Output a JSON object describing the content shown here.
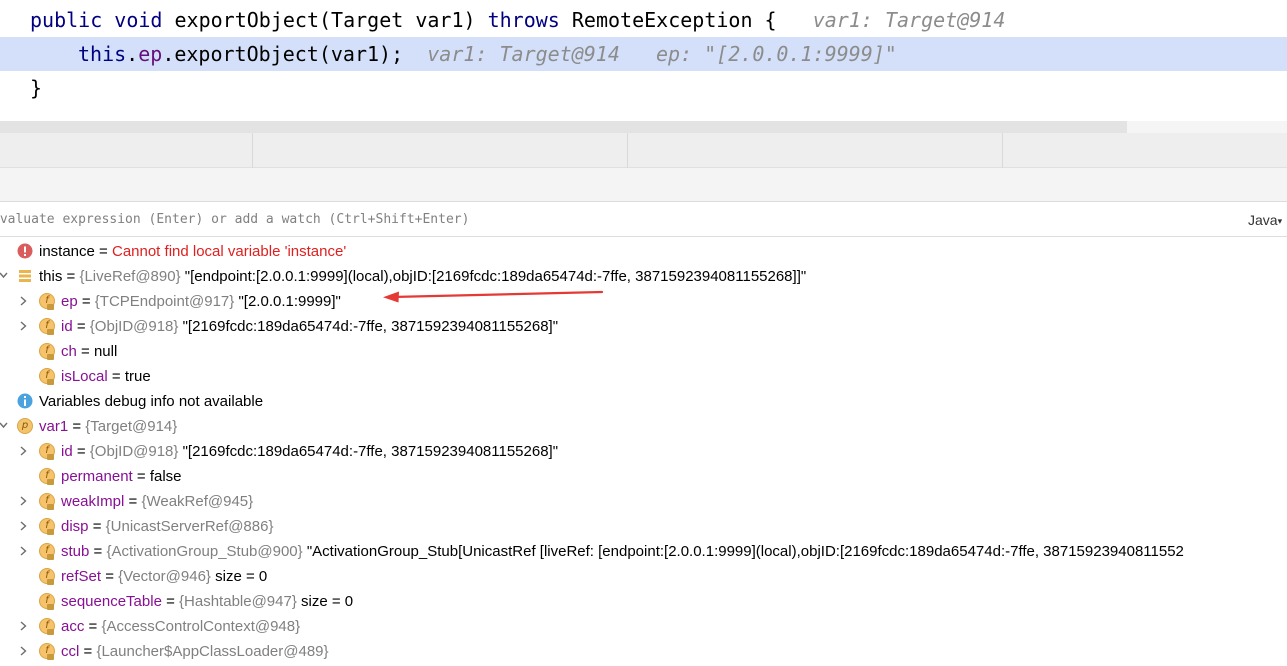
{
  "editor": {
    "line1": {
      "kw_public": "public",
      "kw_void": "void",
      "sig": "exportObject(Target var1)",
      "kw_throws": "throws",
      "tail": "RemoteException {",
      "hint": "var1: Target@914"
    },
    "line2": {
      "kw_this": "this",
      "dot1": ".",
      "field": "ep",
      "call": ".exportObject(var1);",
      "hint1": "var1: Target@914",
      "hint2": "ep: \"[2.0.0.1:9999]\""
    },
    "line3": "}"
  },
  "evaluate": {
    "placeholder": "Evaluate expression (Enter) or add a watch (Ctrl+Shift+Enter)",
    "language": "Java"
  },
  "variables": [
    {
      "name": "instance",
      "eq": " = ",
      "error": "Cannot find local variable 'instance'",
      "icon": "error-icon"
    },
    {
      "name": "this",
      "eq": " = ",
      "ref": "{LiveRef@890}",
      "value": "\"[endpoint:[2.0.0.1:9999](local),objID:[2169fcdc:189da65474d:-7ffe, 3871592394081155268]]\"",
      "icon": "object-icon",
      "expanded": true
    },
    {
      "name": "ep",
      "eq": " = ",
      "ref": "{TCPEndpoint@917}",
      "value": "\"[2.0.0.1:9999]\"",
      "icon": "field-icon",
      "expandable": true
    },
    {
      "name": "id",
      "eq": " = ",
      "ref": "{ObjID@918}",
      "value": "\"[2169fcdc:189da65474d:-7ffe, 3871592394081155268]\"",
      "icon": "field-icon",
      "expandable": true
    },
    {
      "name": "ch",
      "eq": " = ",
      "value": "null",
      "icon": "field-icon"
    },
    {
      "name": "isLocal",
      "eq": " = ",
      "value": "true",
      "icon": "field-icon"
    },
    {
      "info": "Variables debug info not available",
      "icon": "info-icon"
    },
    {
      "name": "var1",
      "eq": " = ",
      "ref": "{Target@914}",
      "icon": "param-icon",
      "expanded": true
    },
    {
      "name": "id",
      "eq": " = ",
      "ref": "{ObjID@918}",
      "value": "\"[2169fcdc:189da65474d:-7ffe, 3871592394081155268]\"",
      "icon": "field-icon",
      "expandable": true
    },
    {
      "name": "permanent",
      "eq": " = ",
      "value": "false",
      "icon": "field-icon"
    },
    {
      "name": "weakImpl",
      "eq": " = ",
      "ref": "{WeakRef@945}",
      "icon": "field-icon",
      "expandable": true
    },
    {
      "name": "disp",
      "eq": " = ",
      "ref": "{UnicastServerRef@886}",
      "icon": "field-icon",
      "expandable": true
    },
    {
      "name": "stub",
      "eq": " = ",
      "ref": "{ActivationGroup_Stub@900}",
      "value": "\"ActivationGroup_Stub[UnicastRef [liveRef: [endpoint:[2.0.0.1:9999](local),objID:[2169fcdc:189da65474d:-7ffe, 38715923940811552",
      "icon": "field-icon",
      "expandable": true
    },
    {
      "name": "refSet",
      "eq": " = ",
      "ref": "{Vector@946}",
      "value": " size = 0",
      "icon": "field-icon"
    },
    {
      "name": "sequenceTable",
      "eq": " = ",
      "ref": "{Hashtable@947}",
      "value": " size = 0",
      "icon": "field-icon"
    },
    {
      "name": "acc",
      "eq": " = ",
      "ref": "{AccessControlContext@948}",
      "icon": "field-icon",
      "expandable": true
    },
    {
      "name": "ccl",
      "eq": " = ",
      "ref": "{Launcher$AppClassLoader@489}",
      "icon": "field-icon",
      "expandable": true
    }
  ],
  "colors": {
    "selection": "#d4e0f9",
    "keyword": "#000080",
    "field": "#660e7a",
    "var_name": "#871094",
    "type_ref": "#808080",
    "error": "#e02020",
    "annotation": "#e53935"
  }
}
